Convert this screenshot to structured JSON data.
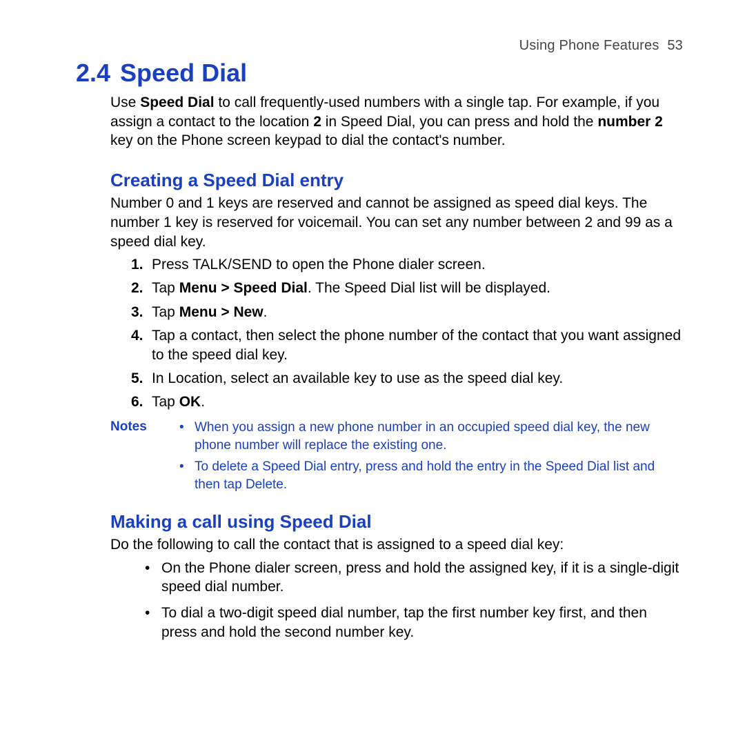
{
  "header": {
    "chapter": "Using Phone Features",
    "page": "53"
  },
  "section": {
    "number": "2.4",
    "title": "Speed Dial"
  },
  "intro": {
    "pre1": "Use ",
    "bold1": "Speed Dial",
    "post1": " to call frequently-used numbers with a single tap. For example, if you assign a contact to the location ",
    "bold2": "2",
    "post2": " in Speed Dial, you can press and hold the ",
    "bold3": "number 2",
    "post3": " key on the Phone screen keypad to dial the contact's number."
  },
  "sub1": {
    "title": "Creating a Speed Dial entry",
    "body": "Number 0 and 1 keys are reserved and cannot be assigned as speed dial keys. The number 1 key is reserved for voicemail. You can set any number between 2 and 99 as a speed dial key."
  },
  "steps": {
    "s1": {
      "num": "1.",
      "text": "Press TALK/SEND to open the Phone dialer screen."
    },
    "s2": {
      "num": "2.",
      "pre": "Tap ",
      "bold": "Menu > Speed Dial",
      "post": ". The Speed Dial list will be displayed."
    },
    "s3": {
      "num": "3.",
      "pre": "Tap ",
      "bold": "Menu > New",
      "post": "."
    },
    "s4": {
      "num": "4.",
      "text": "Tap a contact, then select the phone number of the contact that you want assigned to the speed dial key."
    },
    "s5": {
      "num": "5.",
      "text": "In Location, select an available key to use as the speed dial key."
    },
    "s6": {
      "num": "6.",
      "pre": "Tap ",
      "bold": "OK",
      "post": "."
    }
  },
  "notes": {
    "label": "Notes",
    "n1": "When you assign a new phone number in an occupied speed dial key, the new phone number will replace the existing one.",
    "n2": "To delete a Speed Dial entry, press and hold the entry in the Speed Dial list and then tap Delete."
  },
  "sub2": {
    "title": "Making a call using Speed Dial",
    "body": "Do the following to call the contact that is assigned to a speed dial key:"
  },
  "bullets": {
    "b1": "On the Phone dialer screen, press and hold the assigned key, if it is a single-digit speed dial number.",
    "b2": "To dial a two-digit speed dial number, tap the first number key first, and then press and hold the second number key."
  }
}
